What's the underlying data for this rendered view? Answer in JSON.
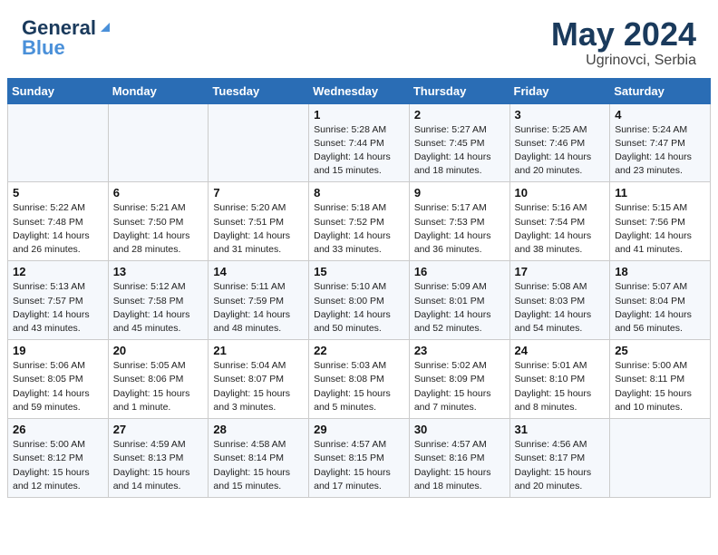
{
  "header": {
    "logo_general": "General",
    "logo_blue": "Blue",
    "title": "May 2024",
    "location": "Ugrinovci, Serbia"
  },
  "weekdays": [
    "Sunday",
    "Monday",
    "Tuesday",
    "Wednesday",
    "Thursday",
    "Friday",
    "Saturday"
  ],
  "weeks": [
    [
      {
        "day": "",
        "info": ""
      },
      {
        "day": "",
        "info": ""
      },
      {
        "day": "",
        "info": ""
      },
      {
        "day": "1",
        "info": "Sunrise: 5:28 AM\nSunset: 7:44 PM\nDaylight: 14 hours\nand 15 minutes."
      },
      {
        "day": "2",
        "info": "Sunrise: 5:27 AM\nSunset: 7:45 PM\nDaylight: 14 hours\nand 18 minutes."
      },
      {
        "day": "3",
        "info": "Sunrise: 5:25 AM\nSunset: 7:46 PM\nDaylight: 14 hours\nand 20 minutes."
      },
      {
        "day": "4",
        "info": "Sunrise: 5:24 AM\nSunset: 7:47 PM\nDaylight: 14 hours\nand 23 minutes."
      }
    ],
    [
      {
        "day": "5",
        "info": "Sunrise: 5:22 AM\nSunset: 7:48 PM\nDaylight: 14 hours\nand 26 minutes."
      },
      {
        "day": "6",
        "info": "Sunrise: 5:21 AM\nSunset: 7:50 PM\nDaylight: 14 hours\nand 28 minutes."
      },
      {
        "day": "7",
        "info": "Sunrise: 5:20 AM\nSunset: 7:51 PM\nDaylight: 14 hours\nand 31 minutes."
      },
      {
        "day": "8",
        "info": "Sunrise: 5:18 AM\nSunset: 7:52 PM\nDaylight: 14 hours\nand 33 minutes."
      },
      {
        "day": "9",
        "info": "Sunrise: 5:17 AM\nSunset: 7:53 PM\nDaylight: 14 hours\nand 36 minutes."
      },
      {
        "day": "10",
        "info": "Sunrise: 5:16 AM\nSunset: 7:54 PM\nDaylight: 14 hours\nand 38 minutes."
      },
      {
        "day": "11",
        "info": "Sunrise: 5:15 AM\nSunset: 7:56 PM\nDaylight: 14 hours\nand 41 minutes."
      }
    ],
    [
      {
        "day": "12",
        "info": "Sunrise: 5:13 AM\nSunset: 7:57 PM\nDaylight: 14 hours\nand 43 minutes."
      },
      {
        "day": "13",
        "info": "Sunrise: 5:12 AM\nSunset: 7:58 PM\nDaylight: 14 hours\nand 45 minutes."
      },
      {
        "day": "14",
        "info": "Sunrise: 5:11 AM\nSunset: 7:59 PM\nDaylight: 14 hours\nand 48 minutes."
      },
      {
        "day": "15",
        "info": "Sunrise: 5:10 AM\nSunset: 8:00 PM\nDaylight: 14 hours\nand 50 minutes."
      },
      {
        "day": "16",
        "info": "Sunrise: 5:09 AM\nSunset: 8:01 PM\nDaylight: 14 hours\nand 52 minutes."
      },
      {
        "day": "17",
        "info": "Sunrise: 5:08 AM\nSunset: 8:03 PM\nDaylight: 14 hours\nand 54 minutes."
      },
      {
        "day": "18",
        "info": "Sunrise: 5:07 AM\nSunset: 8:04 PM\nDaylight: 14 hours\nand 56 minutes."
      }
    ],
    [
      {
        "day": "19",
        "info": "Sunrise: 5:06 AM\nSunset: 8:05 PM\nDaylight: 14 hours\nand 59 minutes."
      },
      {
        "day": "20",
        "info": "Sunrise: 5:05 AM\nSunset: 8:06 PM\nDaylight: 15 hours\nand 1 minute."
      },
      {
        "day": "21",
        "info": "Sunrise: 5:04 AM\nSunset: 8:07 PM\nDaylight: 15 hours\nand 3 minutes."
      },
      {
        "day": "22",
        "info": "Sunrise: 5:03 AM\nSunset: 8:08 PM\nDaylight: 15 hours\nand 5 minutes."
      },
      {
        "day": "23",
        "info": "Sunrise: 5:02 AM\nSunset: 8:09 PM\nDaylight: 15 hours\nand 7 minutes."
      },
      {
        "day": "24",
        "info": "Sunrise: 5:01 AM\nSunset: 8:10 PM\nDaylight: 15 hours\nand 8 minutes."
      },
      {
        "day": "25",
        "info": "Sunrise: 5:00 AM\nSunset: 8:11 PM\nDaylight: 15 hours\nand 10 minutes."
      }
    ],
    [
      {
        "day": "26",
        "info": "Sunrise: 5:00 AM\nSunset: 8:12 PM\nDaylight: 15 hours\nand 12 minutes."
      },
      {
        "day": "27",
        "info": "Sunrise: 4:59 AM\nSunset: 8:13 PM\nDaylight: 15 hours\nand 14 minutes."
      },
      {
        "day": "28",
        "info": "Sunrise: 4:58 AM\nSunset: 8:14 PM\nDaylight: 15 hours\nand 15 minutes."
      },
      {
        "day": "29",
        "info": "Sunrise: 4:57 AM\nSunset: 8:15 PM\nDaylight: 15 hours\nand 17 minutes."
      },
      {
        "day": "30",
        "info": "Sunrise: 4:57 AM\nSunset: 8:16 PM\nDaylight: 15 hours\nand 18 minutes."
      },
      {
        "day": "31",
        "info": "Sunrise: 4:56 AM\nSunset: 8:17 PM\nDaylight: 15 hours\nand 20 minutes."
      },
      {
        "day": "",
        "info": ""
      }
    ]
  ]
}
